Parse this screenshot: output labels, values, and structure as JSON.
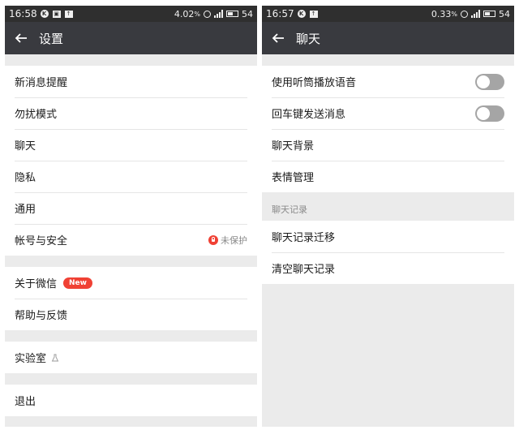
{
  "left": {
    "status": {
      "time": "16:58",
      "icon_k": "K",
      "battery_percent": "4.02",
      "battery_unit": "%",
      "battery_level": "54"
    },
    "header": {
      "title": "设置"
    },
    "groups": [
      {
        "items": [
          {
            "label": "新消息提醒"
          },
          {
            "label": "勿扰模式"
          },
          {
            "label": "聊天"
          },
          {
            "label": "隐私"
          },
          {
            "label": "通用"
          },
          {
            "label": "帐号与安全",
            "status": "未保护"
          }
        ]
      },
      {
        "items": [
          {
            "label": "关于微信",
            "badge": "New"
          },
          {
            "label": "帮助与反馈"
          }
        ]
      },
      {
        "items": [
          {
            "label": "实验室"
          }
        ]
      },
      {
        "items": [
          {
            "label": "退出"
          }
        ]
      }
    ]
  },
  "right": {
    "status": {
      "time": "16:57",
      "icon_k": "K",
      "battery_percent": "0.33",
      "battery_unit": "%",
      "battery_level": "54"
    },
    "header": {
      "title": "聊天"
    },
    "toggles": [
      {
        "label": "使用听筒播放语音",
        "on": false
      },
      {
        "label": "回车键发送消息",
        "on": false
      }
    ],
    "items": [
      {
        "label": "聊天背景"
      },
      {
        "label": "表情管理"
      }
    ],
    "section": {
      "header": "聊天记录",
      "items": [
        {
          "label": "聊天记录迁移"
        },
        {
          "label": "清空聊天记录"
        }
      ]
    }
  },
  "icons": [
    "k-icon",
    "image-icon",
    "upload-icon",
    "alarm-clock-icon",
    "signal-icon",
    "battery-icon",
    "back-arrow-icon",
    "lock-icon",
    "flask-icon"
  ],
  "colors": {
    "statusbar": "#2f2f2f",
    "appbar": "#393a3f",
    "background": "#ebebeb",
    "accent_red": "#f04134",
    "toggle_off": "#a5a5a5"
  }
}
